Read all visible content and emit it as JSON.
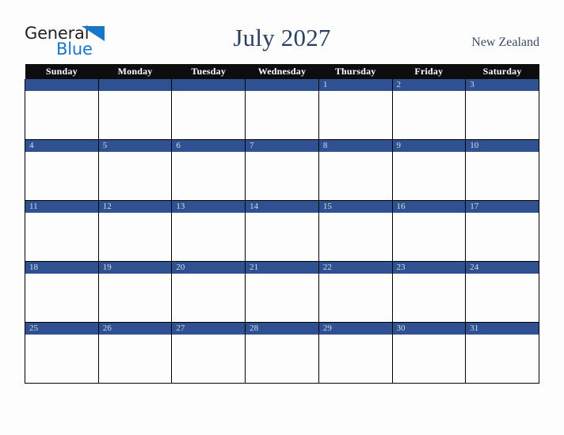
{
  "logo": {
    "word1": "General",
    "word2": "Blue",
    "triangle_icon": "blue-triangle-icon",
    "color1": "#231f20",
    "color2": "#1877c9"
  },
  "header": {
    "title": "July 2027",
    "country": "New Zealand",
    "title_color": "#2b3f63",
    "country_color": "#3b4a68"
  },
  "calendar": {
    "month": "July",
    "year": "2027",
    "header_bg": "#0d0d0d",
    "banner_bg": "#2f5192",
    "banner_text_color": "#d6dce8",
    "weekdays": [
      "Sunday",
      "Monday",
      "Tuesday",
      "Wednesday",
      "Thursday",
      "Friday",
      "Saturday"
    ],
    "weeks": [
      [
        {
          "date": ""
        },
        {
          "date": ""
        },
        {
          "date": ""
        },
        {
          "date": ""
        },
        {
          "date": "1"
        },
        {
          "date": "2"
        },
        {
          "date": "3"
        }
      ],
      [
        {
          "date": "4"
        },
        {
          "date": "5"
        },
        {
          "date": "6"
        },
        {
          "date": "7"
        },
        {
          "date": "8"
        },
        {
          "date": "9"
        },
        {
          "date": "10"
        }
      ],
      [
        {
          "date": "11"
        },
        {
          "date": "12"
        },
        {
          "date": "13"
        },
        {
          "date": "14"
        },
        {
          "date": "15"
        },
        {
          "date": "16"
        },
        {
          "date": "17"
        }
      ],
      [
        {
          "date": "18"
        },
        {
          "date": "19"
        },
        {
          "date": "20"
        },
        {
          "date": "21"
        },
        {
          "date": "22"
        },
        {
          "date": "23"
        },
        {
          "date": "24"
        }
      ],
      [
        {
          "date": "25"
        },
        {
          "date": "26"
        },
        {
          "date": "27"
        },
        {
          "date": "28"
        },
        {
          "date": "29"
        },
        {
          "date": "30"
        },
        {
          "date": "31"
        }
      ]
    ]
  }
}
